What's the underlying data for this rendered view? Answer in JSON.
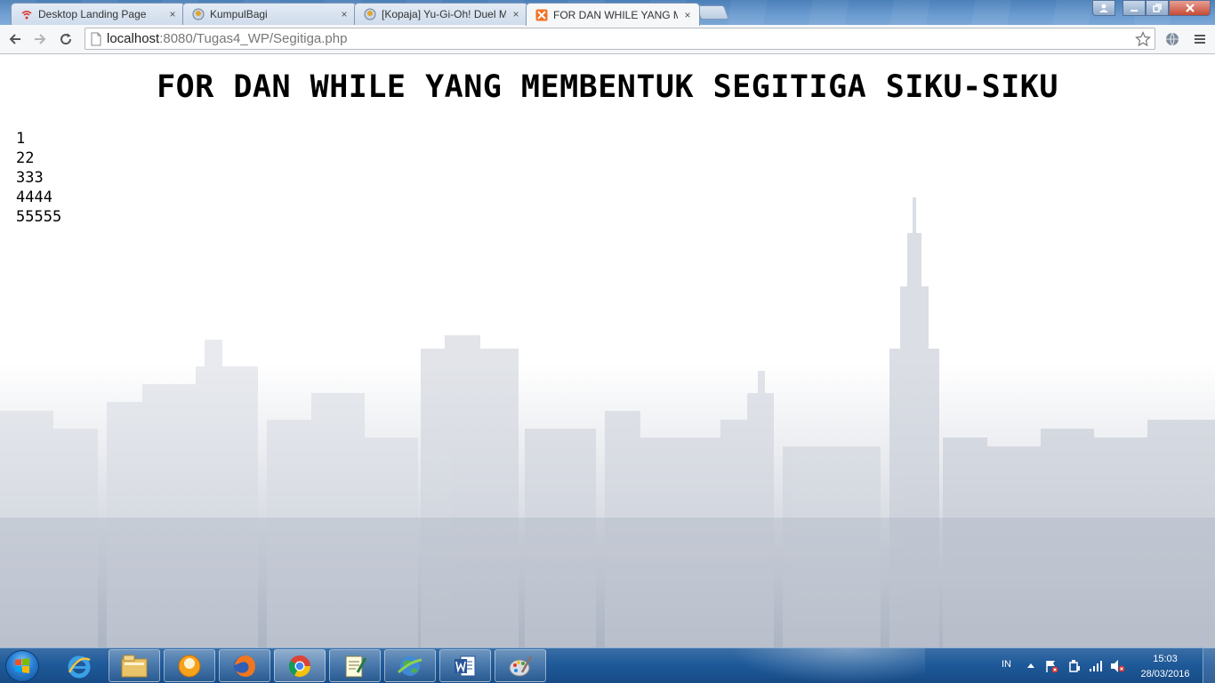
{
  "browser": {
    "tabs": [
      {
        "title": "Desktop Landing Page",
        "icon": "wifi-icon",
        "active": false
      },
      {
        "title": "KumpulBagi",
        "icon": "cloud-icon",
        "active": false
      },
      {
        "title": "[Kopaja] Yu-Gi-Oh! Duel M",
        "icon": "cloud-icon",
        "active": false
      },
      {
        "title": "FOR DAN WHILE YANG M",
        "icon": "xampp-icon",
        "active": true
      }
    ],
    "tab_close_glyph": "×",
    "address": {
      "host": "localhost",
      "path": ":8080/Tugas4_WP/Segitiga.php"
    }
  },
  "page": {
    "heading": "FOR DAN WHILE YANG MEMBENTUK SEGITIGA SIKU-SIKU",
    "triangle_lines": [
      "1",
      "22",
      "333",
      "4444",
      "55555"
    ]
  },
  "taskbar": {
    "apps": [
      "internet-explorer-icon",
      "file-explorer-icon",
      "chat-icon",
      "firefox-icon",
      "chrome-icon",
      "notepad-icon",
      "network-globe-icon",
      "word-icon",
      "paint-icon"
    ],
    "tray": {
      "language": "IN",
      "time": "15:03",
      "date": "28/03/2016"
    }
  },
  "colors": {
    "taskbar": "#1f5a9a",
    "tabstrip": "#6b9bd0",
    "toolbar": "#f6f7f9"
  }
}
